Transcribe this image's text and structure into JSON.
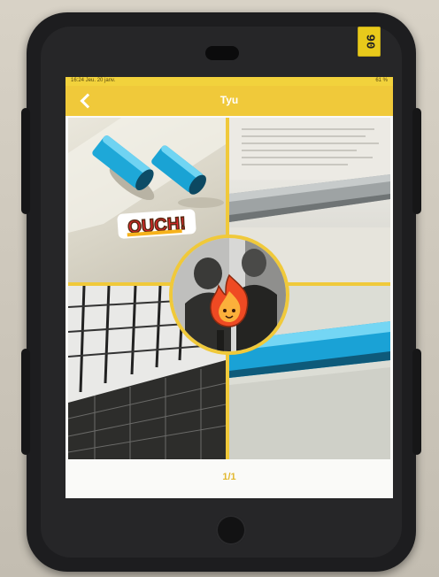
{
  "device": {
    "sticker_text": "90"
  },
  "status_bar": {
    "time": "16:24  Jeu. 20 janv.",
    "battery": "61 %"
  },
  "nav": {
    "title": "Tyu",
    "back_icon": "chevron-left-icon"
  },
  "collage": {
    "sticker_text": "OUCH!",
    "emoji": "fire-face-sticker"
  },
  "pager": {
    "label": "1/1"
  },
  "colors": {
    "nav_yellow": "#f0c93a",
    "frame_yellow": "#f0c93a",
    "case_black": "#1d1d1f",
    "tube_blue": "#1ea8d8"
  }
}
